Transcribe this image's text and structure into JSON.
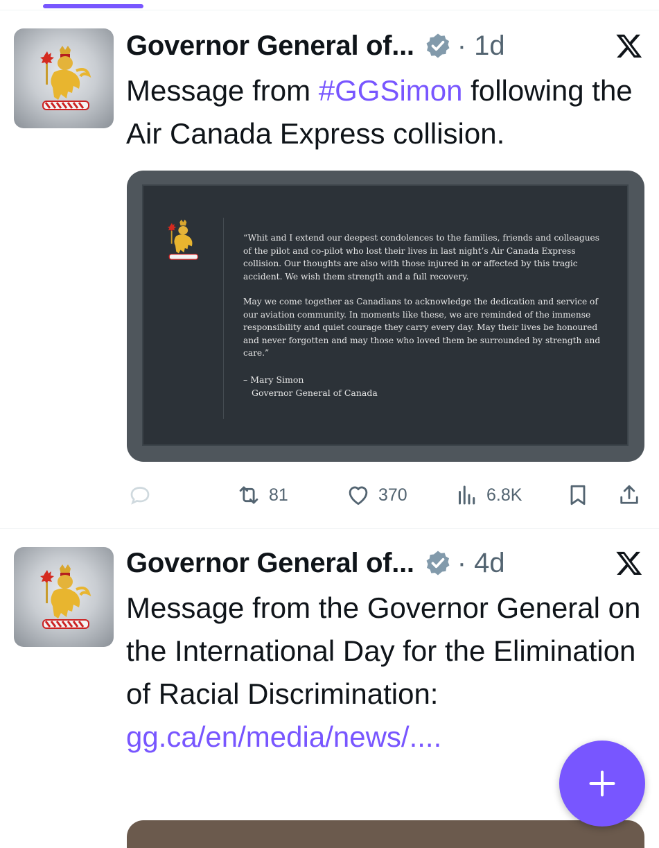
{
  "posts": [
    {
      "author": "Governor General of...",
      "time": "· 1d",
      "text_before": "Message from ",
      "hashtag": "#GGSimon",
      "text_after": " following the Air Canada Express collision.",
      "media": {
        "quote_p1": "“Whit and I extend our deepest condolences to the families, friends and colleagues of the pilot and co-pilot who lost their lives in last night’s Air Canada Express collision. Our thoughts are also with those injured in or affected by this tragic accident. We wish them strength and a full recovery.",
        "quote_p2": "May we come together as Canadians to acknowledge the dedication and service of our aviation community. In moments like these, we are reminded of the immense responsibility and quiet courage they carry every day. May their lives be honoured and never forgotten and may those who loved them be surrounded by strength and care.”",
        "signature_name": "– Mary Simon",
        "signature_title": "Governor General of Canada"
      },
      "stats": {
        "reposts": "81",
        "likes": "370",
        "views": "6.8K"
      }
    },
    {
      "author": "Governor General of...",
      "time": "· 4d",
      "text": "Message from the Governor General on the International Day for the Elimination of Racial Discrimination: ",
      "link": "gg.ca/en/media/​news/...."
    }
  ],
  "colors": {
    "accent": "#7856ff",
    "text": "#0f1419",
    "muted": "#536471"
  },
  "icons": [
    "verified-badge-icon",
    "x-logo-icon",
    "reply-icon",
    "repost-icon",
    "like-icon",
    "views-icon",
    "bookmark-icon",
    "share-icon",
    "compose-plus-icon"
  ]
}
